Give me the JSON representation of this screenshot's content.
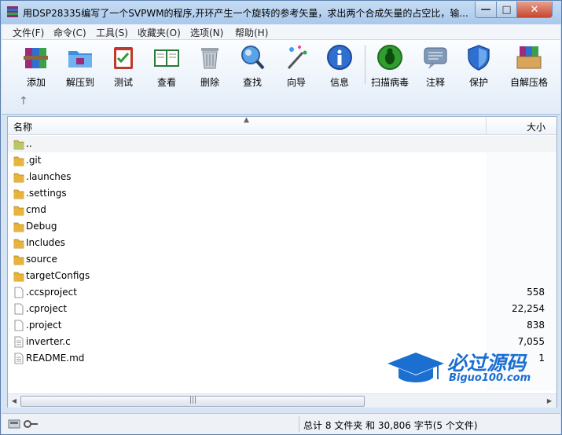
{
  "window": {
    "title": "用DSP28335编写了一个SVPWM的程序,开环产生一个旋转的参考矢量，求出两个合成矢量的占空比，输...",
    "min_glyph": "—",
    "max_glyph": "□",
    "close_glyph": "✕"
  },
  "menu": [
    "文件(F)",
    "命令(C)",
    "工具(S)",
    "收藏夹(O)",
    "选项(N)",
    "帮助(H)"
  ],
  "toolbar": [
    {
      "label": "添加",
      "icon": "add-archive-icon"
    },
    {
      "label": "解压到",
      "icon": "extract-folder-icon"
    },
    {
      "label": "测试",
      "icon": "test-clipboard-icon"
    },
    {
      "label": "查看",
      "icon": "view-book-icon"
    },
    {
      "label": "删除",
      "icon": "trash-icon"
    },
    {
      "label": "查找",
      "icon": "magnifier-icon"
    },
    {
      "label": "向导",
      "icon": "wizard-wand-icon"
    },
    {
      "label": "信息",
      "icon": "info-icon"
    },
    {
      "label": "扫描病毒",
      "icon": "virus-scan-icon"
    },
    {
      "label": "注释",
      "icon": "comment-icon"
    },
    {
      "label": "保护",
      "icon": "shield-icon"
    },
    {
      "label": "自解压格",
      "icon": "sfx-box-icon"
    }
  ],
  "up_glyph": "↑",
  "columns": {
    "name": "名称",
    "size": "大小",
    "sort_glyph": "▲"
  },
  "files": [
    {
      "name": "..",
      "size": "",
      "type": "parent"
    },
    {
      "name": ".git",
      "size": "",
      "type": "folder"
    },
    {
      "name": ".launches",
      "size": "",
      "type": "folder"
    },
    {
      "name": ".settings",
      "size": "",
      "type": "folder"
    },
    {
      "name": "cmd",
      "size": "",
      "type": "folder"
    },
    {
      "name": "Debug",
      "size": "",
      "type": "folder"
    },
    {
      "name": "Includes",
      "size": "",
      "type": "folder"
    },
    {
      "name": "source",
      "size": "",
      "type": "folder"
    },
    {
      "name": "targetConfigs",
      "size": "",
      "type": "folder"
    },
    {
      "name": ".ccsproject",
      "size": "558",
      "type": "file"
    },
    {
      "name": ".cproject",
      "size": "22,254",
      "type": "file"
    },
    {
      "name": ".project",
      "size": "838",
      "type": "file"
    },
    {
      "name": "inverter.c",
      "size": "7,055",
      "type": "cfile"
    },
    {
      "name": "README.md",
      "size": "1",
      "type": "text"
    }
  ],
  "scroll": {
    "left": "◀",
    "right": "▶",
    "grip": "|||"
  },
  "status": "总计 8 文件夹 和 30,806 字节(5 个文件)",
  "watermark": {
    "title": "必过源码",
    "subtitle": "Biguo100.com"
  },
  "colors": {
    "folder": "#e8b53a",
    "accent": "#1b6fd1"
  }
}
